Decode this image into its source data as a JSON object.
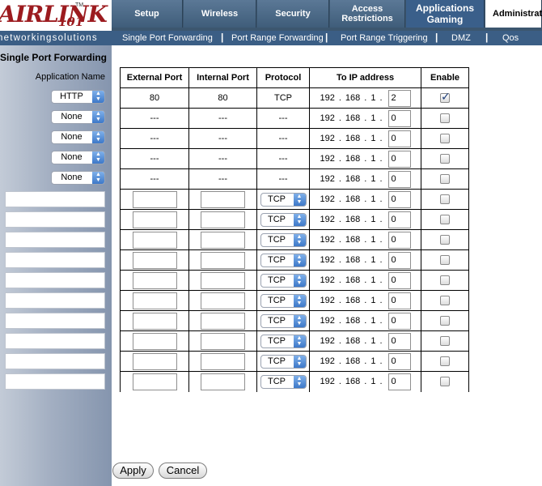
{
  "logo": {
    "brand": "AIRLINK",
    "number": "101",
    "tm": "TM"
  },
  "slogan": "networkingsolutions",
  "nav": {
    "tabs": [
      {
        "label": "Setup"
      },
      {
        "label": "Wireless"
      },
      {
        "label": "Security"
      },
      {
        "label": "Access\nRestrictions"
      },
      {
        "label": "Applications\nGaming"
      },
      {
        "label": "Administration"
      }
    ],
    "active": "Applications Gaming",
    "subtabs": [
      {
        "label": "Single Port Forwarding"
      },
      {
        "label": "Port Range Forwarding"
      },
      {
        "label": "Port Range Triggering"
      },
      {
        "label": "DMZ"
      },
      {
        "label": "Qos"
      }
    ],
    "separator": "|"
  },
  "sidebar": {
    "section_title": "Single Port Forwarding",
    "app_name_label": "Application Name",
    "app_selects": [
      "HTTP",
      "None",
      "None",
      "None",
      "None"
    ],
    "custom_name_rows": 10
  },
  "table": {
    "headers": [
      "External Port",
      "Internal Port",
      "Protocol",
      "To IP address",
      "Enable"
    ],
    "ip_prefix": [
      "192",
      "168",
      "1"
    ],
    "preset_rows": [
      {
        "external": "80",
        "internal": "80",
        "protocol": "TCP",
        "last_octet": "2",
        "enabled": true
      },
      {
        "external": "---",
        "internal": "---",
        "protocol": "---",
        "last_octet": "0",
        "enabled": false
      },
      {
        "external": "---",
        "internal": "---",
        "protocol": "---",
        "last_octet": "0",
        "enabled": false
      },
      {
        "external": "---",
        "internal": "---",
        "protocol": "---",
        "last_octet": "0",
        "enabled": false
      },
      {
        "external": "---",
        "internal": "---",
        "protocol": "---",
        "last_octet": "0",
        "enabled": false
      }
    ],
    "custom_rows": [
      {
        "protocol": "TCP",
        "last_octet": "0",
        "enabled": false
      },
      {
        "protocol": "TCP",
        "last_octet": "0",
        "enabled": false
      },
      {
        "protocol": "TCP",
        "last_octet": "0",
        "enabled": false
      },
      {
        "protocol": "TCP",
        "last_octet": "0",
        "enabled": false
      },
      {
        "protocol": "TCP",
        "last_octet": "0",
        "enabled": false
      },
      {
        "protocol": "TCP",
        "last_octet": "0",
        "enabled": false
      },
      {
        "protocol": "TCP",
        "last_octet": "0",
        "enabled": false
      },
      {
        "protocol": "TCP",
        "last_octet": "0",
        "enabled": false
      },
      {
        "protocol": "TCP",
        "last_octet": "0",
        "enabled": false
      },
      {
        "protocol": "TCP",
        "last_octet": "0",
        "enabled": false
      }
    ]
  },
  "buttons": {
    "apply": "Apply",
    "cancel": "Cancel"
  },
  "colors": {
    "nav": "#4a6785",
    "subnav": "#3b5e85",
    "brand": "#9c1b1f",
    "select_arrow": "#4a86d4"
  }
}
